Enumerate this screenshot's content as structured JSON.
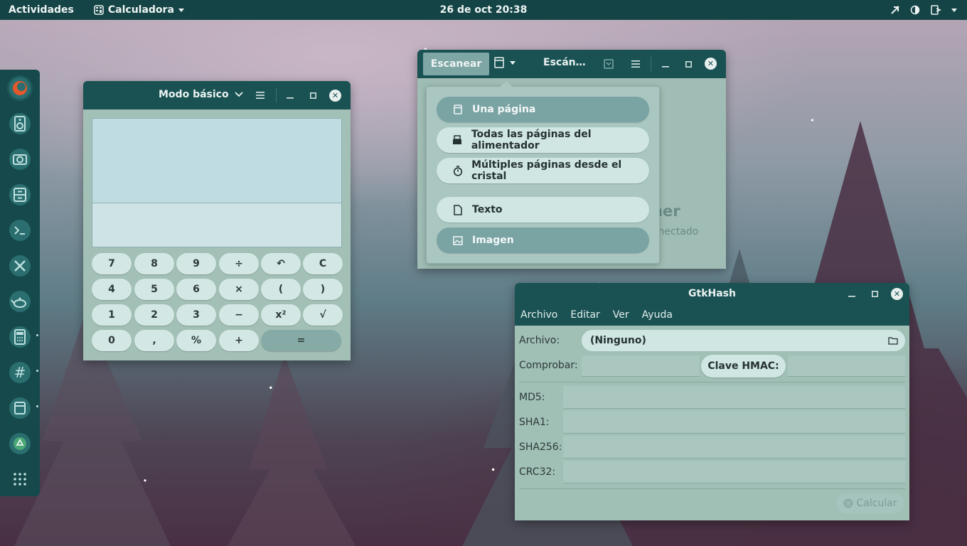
{
  "topbar": {
    "activities": "Actividades",
    "app_name": "Calculadora",
    "clock": "26 de oct  20:38"
  },
  "dock": {
    "items": [
      "firefox-icon",
      "speaker-icon",
      "camera-icon",
      "file-cabinet-icon",
      "terminal-icon",
      "tools-icon",
      "teapot-icon",
      "calculator-icon",
      "hash-icon",
      "scanner-icon",
      "recycle-icon",
      "apps-grid-icon"
    ]
  },
  "calculator": {
    "mode_label": "Modo básico",
    "keys": [
      [
        "7",
        "8",
        "9",
        "÷",
        "↶",
        "C"
      ],
      [
        "4",
        "5",
        "6",
        "×",
        "(",
        ")"
      ],
      [
        "1",
        "2",
        "3",
        "−",
        "x²",
        "√"
      ],
      [
        "0",
        ",",
        "%",
        "+",
        "="
      ]
    ]
  },
  "scanner": {
    "tab_label": "Escanear",
    "device_label": "Escán…",
    "bg_title_fragment": "ner",
    "bg_subtitle_fragment": "onectado",
    "menu": [
      {
        "label": "Una página",
        "selected": true,
        "icon": "single-page-icon"
      },
      {
        "label": "Todas las páginas del alimentador",
        "selected": false,
        "icon": "feeder-icon"
      },
      {
        "label": "Múltiples páginas desde el cristal",
        "selected": false,
        "icon": "timer-icon"
      },
      {
        "label": "Texto",
        "selected": false,
        "icon": "document-icon"
      },
      {
        "label": "Imagen",
        "selected": true,
        "icon": "image-icon"
      }
    ]
  },
  "gtkhash": {
    "title": "GtkHash",
    "menu": [
      "Archivo",
      "Editar",
      "Ver",
      "Ayuda"
    ],
    "archivo_label": "Archivo:",
    "archivo_value": "(Ninguno)",
    "comprobar_label": "Comprobar:",
    "hmac_label": "Clave HMAC:",
    "hashes": [
      "MD5:",
      "SHA1:",
      "SHA256:",
      "CRC32:"
    ],
    "calc_button": "Calcular"
  },
  "colors": {
    "topbar": "#144446",
    "titlebar": "#1a5254",
    "window_bg": "#a3c0b6",
    "button": "#d3e8e5",
    "selected": "#7aa3a4"
  }
}
